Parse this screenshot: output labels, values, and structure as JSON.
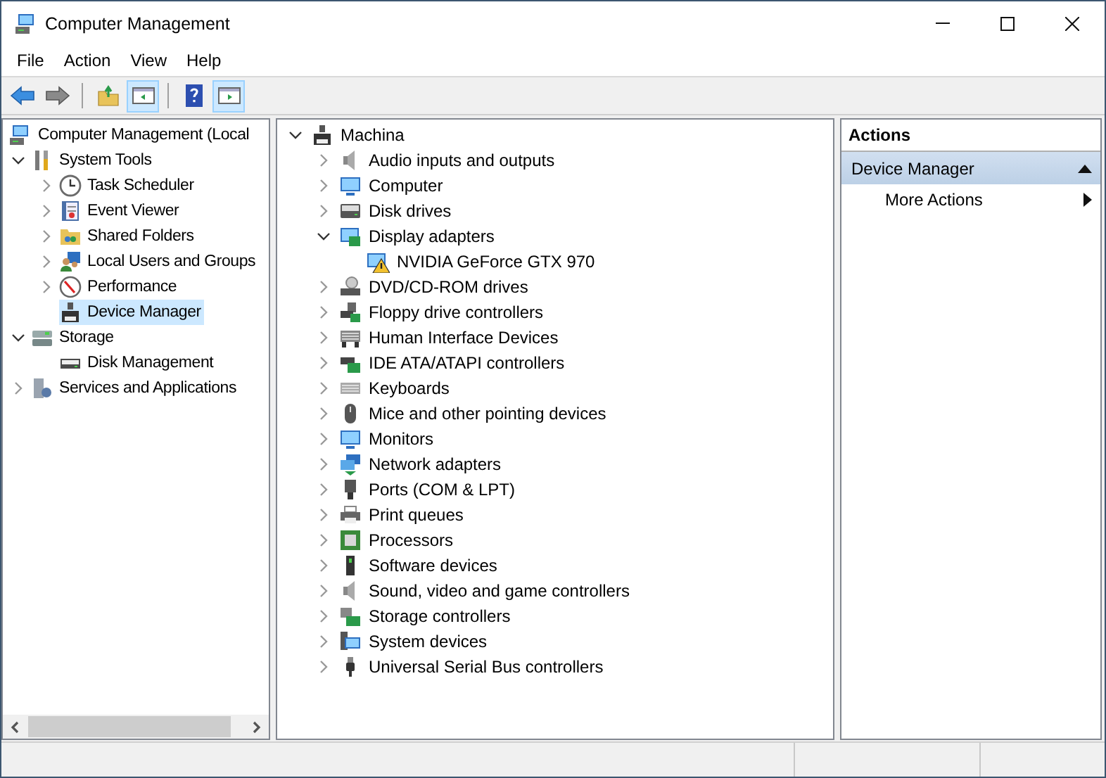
{
  "window": {
    "title": "Computer Management"
  },
  "menu": [
    "File",
    "Action",
    "View",
    "Help"
  ],
  "toolbar": [
    [
      {
        "kind": "back",
        "on": false
      },
      {
        "kind": "forward",
        "on": false
      }
    ],
    [
      {
        "kind": "up",
        "on": false
      },
      {
        "kind": "tree",
        "on": true
      }
    ],
    [
      {
        "kind": "help",
        "on": false
      },
      {
        "kind": "actions",
        "on": true
      }
    ]
  ],
  "console_tree": {
    "label": "Computer Management (Local",
    "selected": false,
    "children": [
      {
        "label": "System Tools",
        "expanded": true,
        "selected": false,
        "children": [
          {
            "label": "Task Scheduler",
            "expanded": false,
            "selected": false
          },
          {
            "label": "Event Viewer",
            "expanded": false,
            "selected": false
          },
          {
            "label": "Shared Folders",
            "expanded": false,
            "selected": false
          },
          {
            "label": "Local Users and Groups",
            "expanded": false,
            "selected": false
          },
          {
            "label": "Performance",
            "expanded": false,
            "selected": false
          },
          {
            "label": "Device Manager",
            "selected": true
          }
        ]
      },
      {
        "label": "Storage",
        "expanded": true,
        "selected": false,
        "children": [
          {
            "label": "Disk Management",
            "selected": false
          }
        ]
      },
      {
        "label": "Services and Applications",
        "expanded": false,
        "selected": false
      }
    ]
  },
  "device_tree": [
    {
      "label": "Machina",
      "expanded": true,
      "children": [
        {
          "label": "Audio inputs and outputs",
          "expanded": false
        },
        {
          "label": "Computer",
          "expanded": false
        },
        {
          "label": "Disk drives",
          "expanded": false
        },
        {
          "label": "Display adapters",
          "expanded": true,
          "children": [
            {
              "label": "NVIDIA GeForce GTX 970",
              "warning": true
            }
          ]
        },
        {
          "label": "DVD/CD-ROM drives",
          "expanded": false
        },
        {
          "label": "Floppy drive controllers",
          "expanded": false
        },
        {
          "label": "Human Interface Devices",
          "expanded": false
        },
        {
          "label": "IDE ATA/ATAPI controllers",
          "expanded": false
        },
        {
          "label": "Keyboards",
          "expanded": false
        },
        {
          "label": "Mice and other pointing devices",
          "expanded": false
        },
        {
          "label": "Monitors",
          "expanded": false
        },
        {
          "label": "Network adapters",
          "expanded": false
        },
        {
          "label": "Ports (COM & LPT)",
          "expanded": false
        },
        {
          "label": "Print queues",
          "expanded": false
        },
        {
          "label": "Processors",
          "expanded": false
        },
        {
          "label": "Software devices",
          "expanded": false
        },
        {
          "label": "Sound, video and game controllers",
          "expanded": false
        },
        {
          "label": "Storage controllers",
          "expanded": false
        },
        {
          "label": "System devices",
          "expanded": false
        },
        {
          "label": "Universal Serial Bus controllers",
          "expanded": false
        }
      ]
    }
  ],
  "actions": {
    "title": "Actions",
    "sections": [
      {
        "title": "Device Manager",
        "expanded": true,
        "items": [
          {
            "label": "More Actions",
            "submenu": true
          }
        ]
      }
    ]
  }
}
